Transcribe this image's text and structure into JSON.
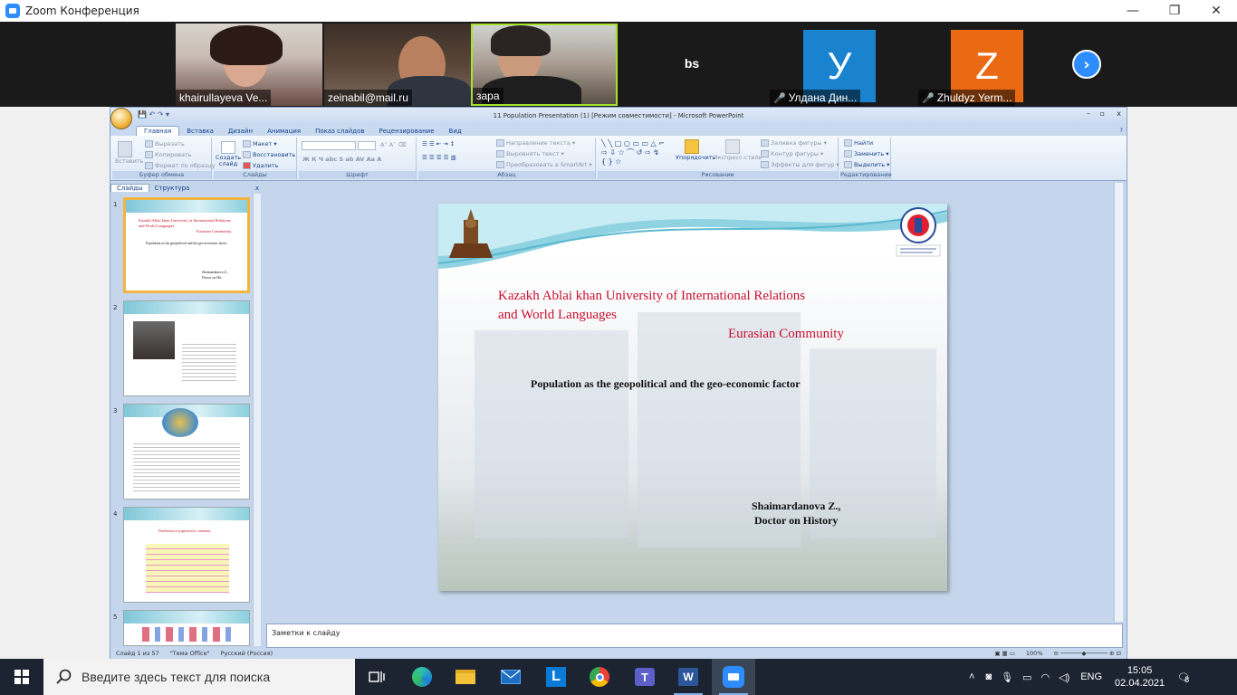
{
  "zoom": {
    "title": "Zoom Конференция",
    "minimize": "—",
    "restore": "❐",
    "close": "✕",
    "participants": [
      {
        "name": "khairullayeva Ve..."
      },
      {
        "name": "zeinabil@mail.ru"
      },
      {
        "name": "зара"
      },
      {
        "name": "bs"
      },
      {
        "name": "Улдана Дин...",
        "initial": "У",
        "color": "#1a83d0"
      },
      {
        "name": "Zhuldyz Yerm...",
        "initial": "Z",
        "color": "#ea6a14"
      }
    ],
    "next_label": "›"
  },
  "ppt": {
    "window_title": "11  Population Presentation (1) [Режим совместимости] - Microsoft PowerPoint",
    "tabs": [
      "Главная",
      "Вставка",
      "Дизайн",
      "Анимация",
      "Показ слайдов",
      "Рецензирование",
      "Вид"
    ],
    "ribbon": {
      "clipboard": {
        "label": "Буфер обмена",
        "paste": "Вставить",
        "cut": "Вырезать",
        "copy": "Копировать",
        "format": "Формат по образцу"
      },
      "slides": {
        "label": "Слайды",
        "new_slide": "Создать слайд",
        "layout": "Макет",
        "reset": "Восстановить",
        "delete": "Удалить"
      },
      "font": {
        "label": "Шрифт"
      },
      "paragraph": {
        "label": "Абзац",
        "text_dir": "Направление текста",
        "align_text": "Выровнять текст",
        "smartart": "Преобразовать в SmartArt"
      },
      "drawing": {
        "label": "Рисование",
        "arrange": "Упорядочить",
        "quick_styles": "Экспресс-стили",
        "fill": "Заливка фигуры",
        "outline": "Контур фигуры",
        "effects": "Эффекты для фигур"
      },
      "editing": {
        "label": "Редактирование",
        "find": "Найти",
        "replace": "Заменить",
        "select": "Выделить"
      }
    },
    "left_tabs": [
      "Слайды",
      "Структура"
    ],
    "thumbnails": [
      {
        "num": "1",
        "line1": "Kazakh Ablai khan University of International Relations",
        "line2": "and World Languages",
        "line3": "Eurasian Community",
        "line4": "Population as the geopolitical and the geo-economic factor",
        "line5": "Shaimardanova Z.,",
        "line6": "Doctor on His"
      },
      {
        "num": "2"
      },
      {
        "num": "3"
      },
      {
        "num": "4",
        "title": "Distribution of population by continents"
      },
      {
        "num": "5"
      }
    ],
    "slide": {
      "univ_line1": "Kazakh Ablai khan University of International Relations",
      "univ_line2": "and World Languages",
      "community": "Eurasian Community",
      "topic": "Population as the geopolitical and the geo-economic factor",
      "author": "Shaimardanova Z.,",
      "degree": "Doctor  on History"
    },
    "notes_placeholder": "Заметки к слайду",
    "status": {
      "slide_count": "Слайд 1 из 57",
      "theme": "\"Тема Office\"",
      "language": "Русский (Россия)",
      "zoom": "100%"
    }
  },
  "taskbar": {
    "search_placeholder": "Введите здесь текст для поиска",
    "language": "ENG",
    "time": "15:05",
    "date": "02.04.2021",
    "notifications": "8"
  },
  "colors": {
    "zoom_blue": "#2D8CFF",
    "slide_red": "#c8102e",
    "taskbar": "#1c2431"
  }
}
